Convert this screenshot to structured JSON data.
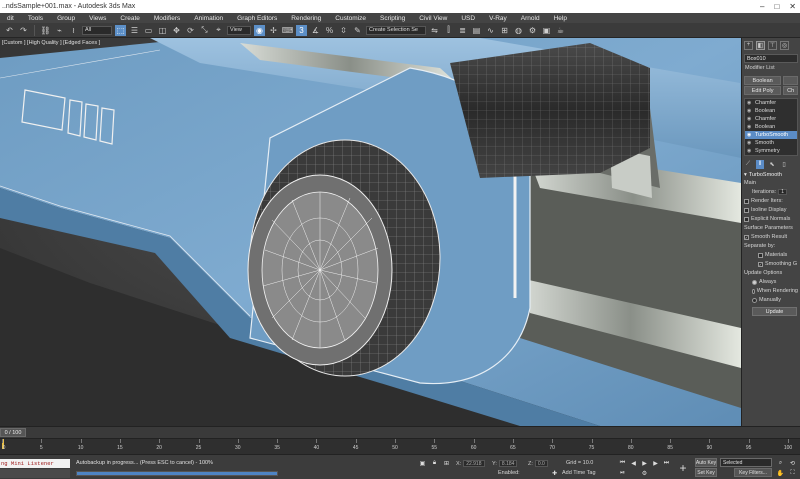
{
  "window": {
    "title": "..ndsSample+001.max - Autodesk 3ds Max",
    "minimize": "–",
    "maximize": "□",
    "close": "✕"
  },
  "menu": [
    "dit",
    "Tools",
    "Group",
    "Views",
    "Create",
    "Modifiers",
    "Animation",
    "Graph Editors",
    "Rendering",
    "Customize",
    "Scripting",
    "Civil View",
    "USD",
    "V-Ray",
    "Arnold",
    "Help"
  ],
  "toolbar": {
    "filter_select": "All",
    "coord_select": "View",
    "selection_set": "Create Selection Se"
  },
  "viewport": {
    "label": "[Custom ] [High Quality ] [Edged Faces ]"
  },
  "command_panel": {
    "object_name": "Box010",
    "modifier_list_label": "Modifier List",
    "buttons_row1": [
      "Boolean",
      ""
    ],
    "buttons_row2": [
      "Edit Poly",
      "Ch"
    ],
    "stack": [
      {
        "label": "Chamfer",
        "selected": false
      },
      {
        "label": "Boolean",
        "selected": false
      },
      {
        "label": "Chamfer",
        "selected": false
      },
      {
        "label": "Boolean",
        "selected": false
      },
      {
        "label": "TurboSmooth",
        "selected": true
      },
      {
        "label": "Smooth",
        "selected": false
      },
      {
        "label": "Symmetry",
        "selected": false
      }
    ],
    "rollout_title": "TurboSmooth",
    "main_label": "Main",
    "iterations_label": "Iterations:",
    "iterations_value": "1",
    "render_iters_label": "Render Iters:",
    "isoline_display": "Isoline Display",
    "explicit_normals": "Explicit Normals",
    "surface_params_label": "Surface Parameters",
    "smooth_result": "Smooth Result",
    "separate_by_label": "Separate by:",
    "materials_label": "Materials",
    "smoothing_groups_label": "Smoothing G",
    "update_options_label": "Update Options",
    "always_label": "Always",
    "when_rendering_label": "When Rendering",
    "manually_label": "Manually",
    "update_button": "Update"
  },
  "timeline": {
    "frame_box": "0 / 100",
    "ticks": [
      "0",
      "5",
      "10",
      "15",
      "20",
      "25",
      "30",
      "35",
      "40",
      "45",
      "50",
      "55",
      "60",
      "65",
      "70",
      "75",
      "80",
      "85",
      "90",
      "95",
      "100"
    ],
    "current_frame_fraction": 0
  },
  "status": {
    "maxscript": "ng Mini Listener",
    "message": "Autobackup in progress... (Press ESC to cancel) - 100%",
    "progress_percent": 100,
    "x_label": "X:",
    "x_value": "22.918",
    "y_label": "Y:",
    "y_value": "8.184",
    "z_label": "Z:",
    "z_value": "0.0",
    "grid": "Grid = 10.0",
    "enabled_label": "Enabled:",
    "add_time_tag": "Add Time Tag",
    "auto_key": "Auto Key",
    "set_key": "Set Key",
    "selected": "Selected",
    "key_filters": "Key Filters..."
  },
  "colors": {
    "accent": "#5b8cc6",
    "model_surface": "#7aa8cc",
    "viewport_bg": "#3a3a3a"
  }
}
